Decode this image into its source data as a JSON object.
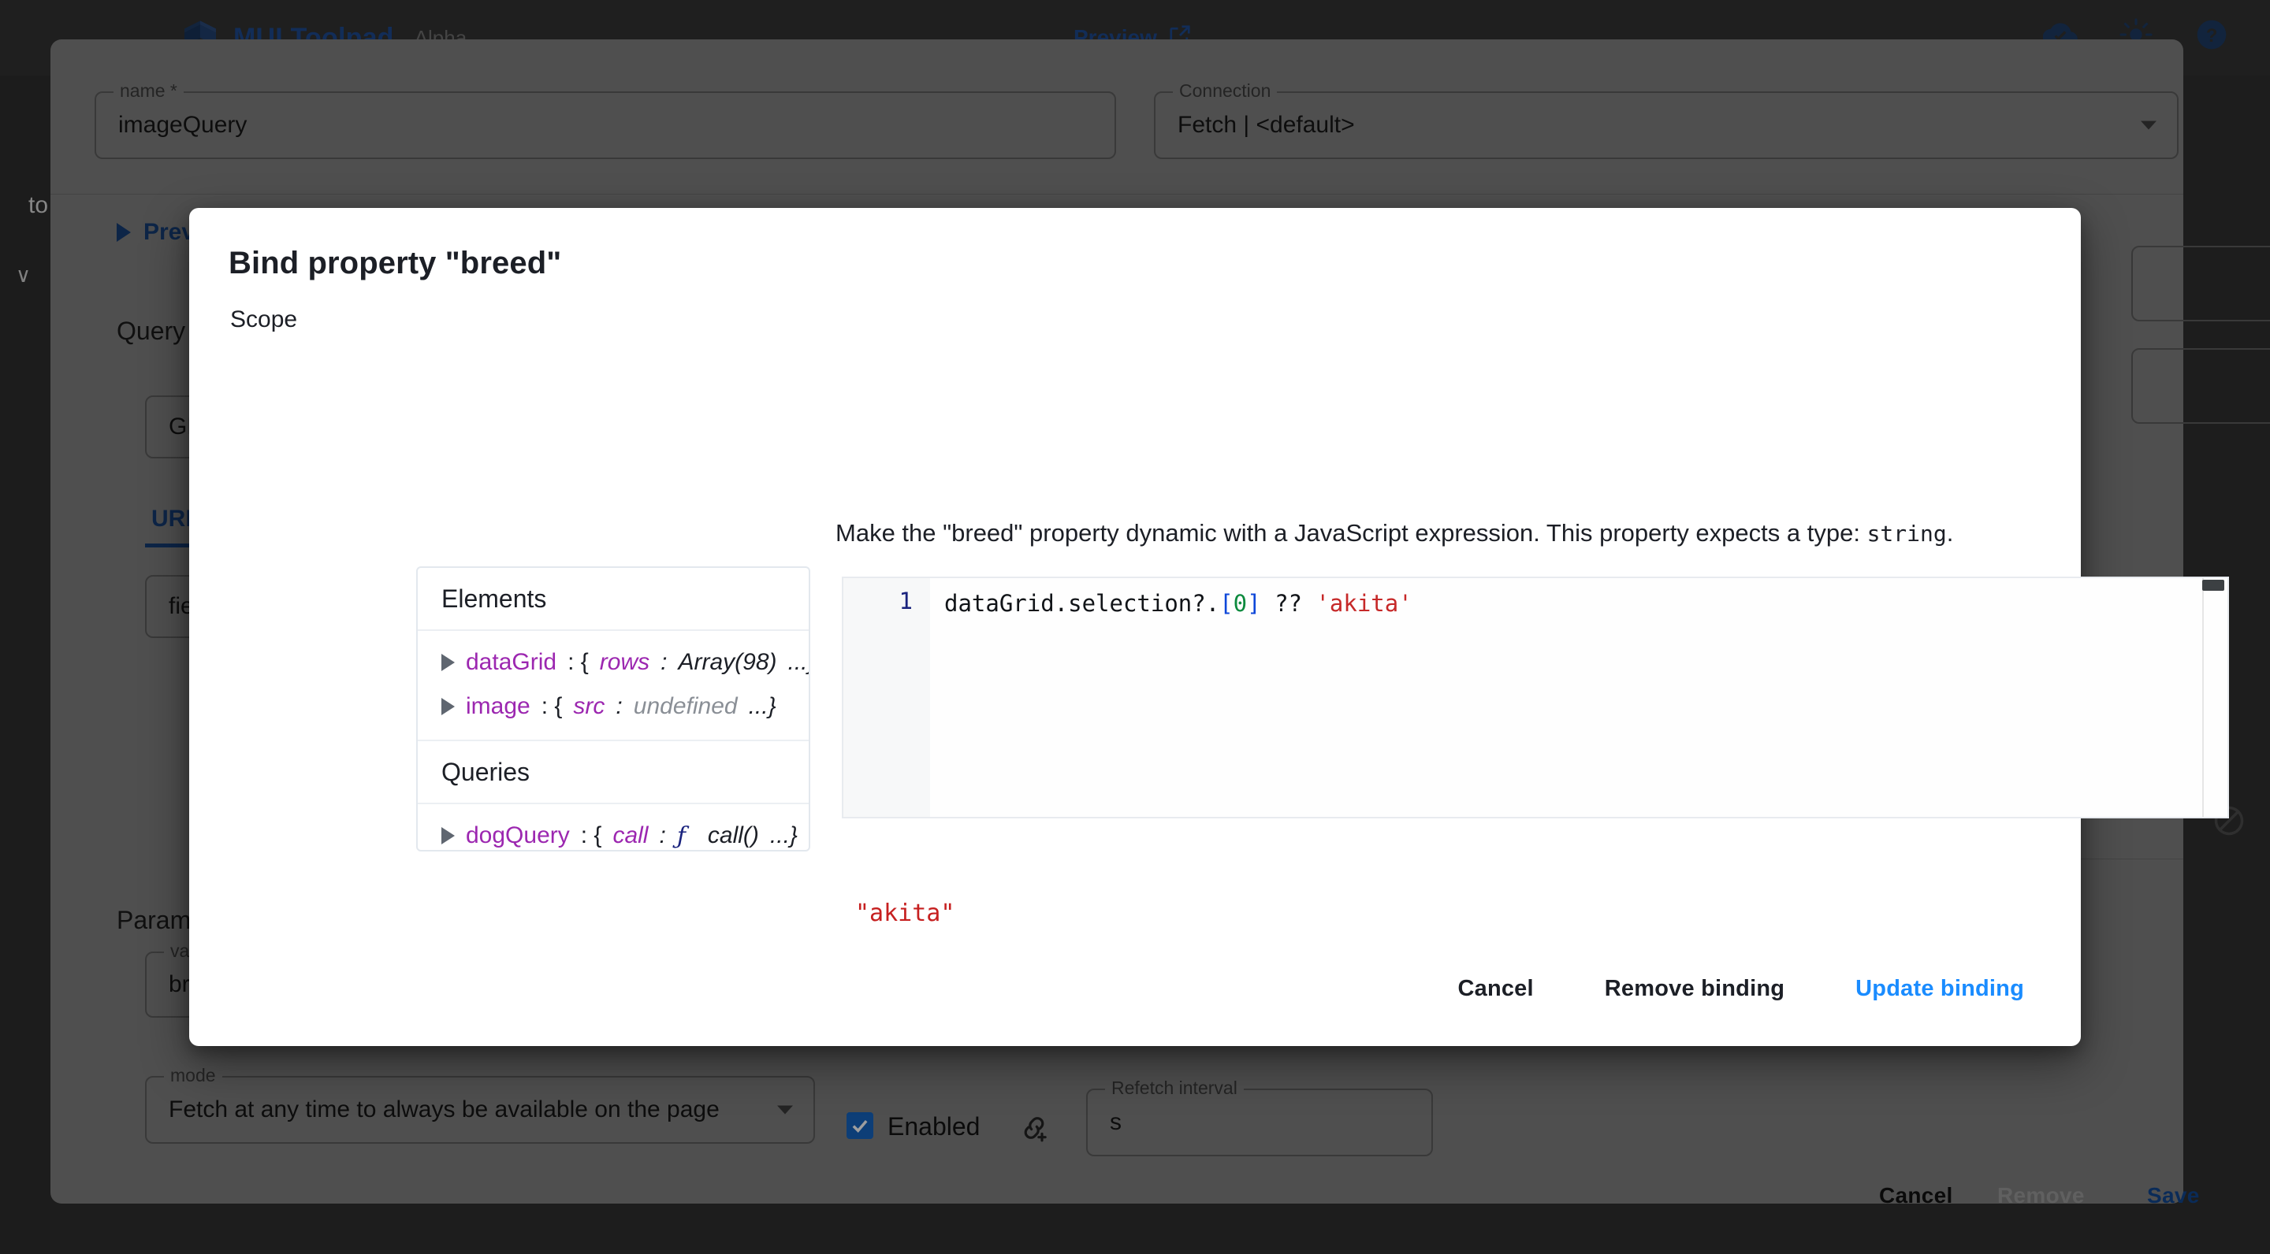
{
  "appbar": {
    "brand": "MUI Toolpad",
    "badge": "Alpha",
    "preview_label": "Preview",
    "icons": [
      {
        "name": "cloud-check-icon",
        "label": "cloud-check"
      },
      {
        "name": "brightness-icon",
        "label": "brightness"
      },
      {
        "name": "help-icon",
        "label": "help"
      }
    ]
  },
  "left_rail": {
    "text": "to",
    "chevron": "∨"
  },
  "query_panel": {
    "name_field": {
      "label": "name *",
      "value": "imageQuery"
    },
    "connection_field": {
      "label": "Connection",
      "value": "Fetch | <default>"
    },
    "preview_toggle": "Preview",
    "query_heading": "Query",
    "method_field": {
      "value": "GET"
    },
    "tab_active": "URL query",
    "field_input": {
      "value": "field"
    },
    "parameters_heading": "Parameters",
    "value_field": {
      "label": "value",
      "value": "breed"
    },
    "mode_field": {
      "label": "mode",
      "value": "Fetch at any time to always be available on the page"
    },
    "enabled_checkbox": {
      "label": "Enabled",
      "checked": true
    },
    "refetch_field": {
      "label": "Refetch interval",
      "value": "s"
    },
    "footer": {
      "cancel": "Cancel",
      "remove": "Remove",
      "save": "Save"
    }
  },
  "dialog": {
    "title": "Bind property \"breed\"",
    "scope_label": "Scope",
    "scope": {
      "sections": [
        {
          "header": "Elements",
          "items": [
            {
              "key": "dataGrid",
              "sep": ": {",
              "prop": "rows",
              "prop_sep": ": ",
              "value": "Array(98)",
              "tail": "...}",
              "value_kind": "value"
            },
            {
              "key": "image",
              "sep": ": {",
              "prop": "src",
              "prop_sep": ": ",
              "value": "undefined",
              "tail": "...}",
              "value_kind": "undefined"
            }
          ]
        },
        {
          "header": "Queries",
          "items": [
            {
              "key": "dogQuery",
              "sep": ": {",
              "prop": "call",
              "prop_sep": ": ",
              "value": "call()",
              "tail": "...}",
              "value_kind": "function",
              "fn_glyph": "ƒ"
            }
          ]
        }
      ]
    },
    "description": {
      "text_before": "Make the \"breed\" property dynamic with a JavaScript expression. This property expects a type: ",
      "type_name": "string",
      "text_after": "."
    },
    "editor": {
      "line_number": "1",
      "code_plain_1": "dataGrid.selection?.",
      "code_bracket_open": "[",
      "code_number": "0",
      "code_bracket_close": "]",
      "code_plain_2": " ?? ",
      "code_string": "'akita'"
    },
    "preview_value": "\"akita\"",
    "actions": {
      "cancel": "Cancel",
      "remove_binding": "Remove binding",
      "update_binding": "Update binding"
    }
  },
  "colors": {
    "brand_blue": "#1d4a8f",
    "accent_blue": "#1a8cff",
    "scope_key_purple": "#9c27b0",
    "string_red": "#c62828",
    "number_green": "#0c8a3e",
    "bracket_blue": "#0d47d9",
    "checkbox_blue": "#1565c0"
  }
}
